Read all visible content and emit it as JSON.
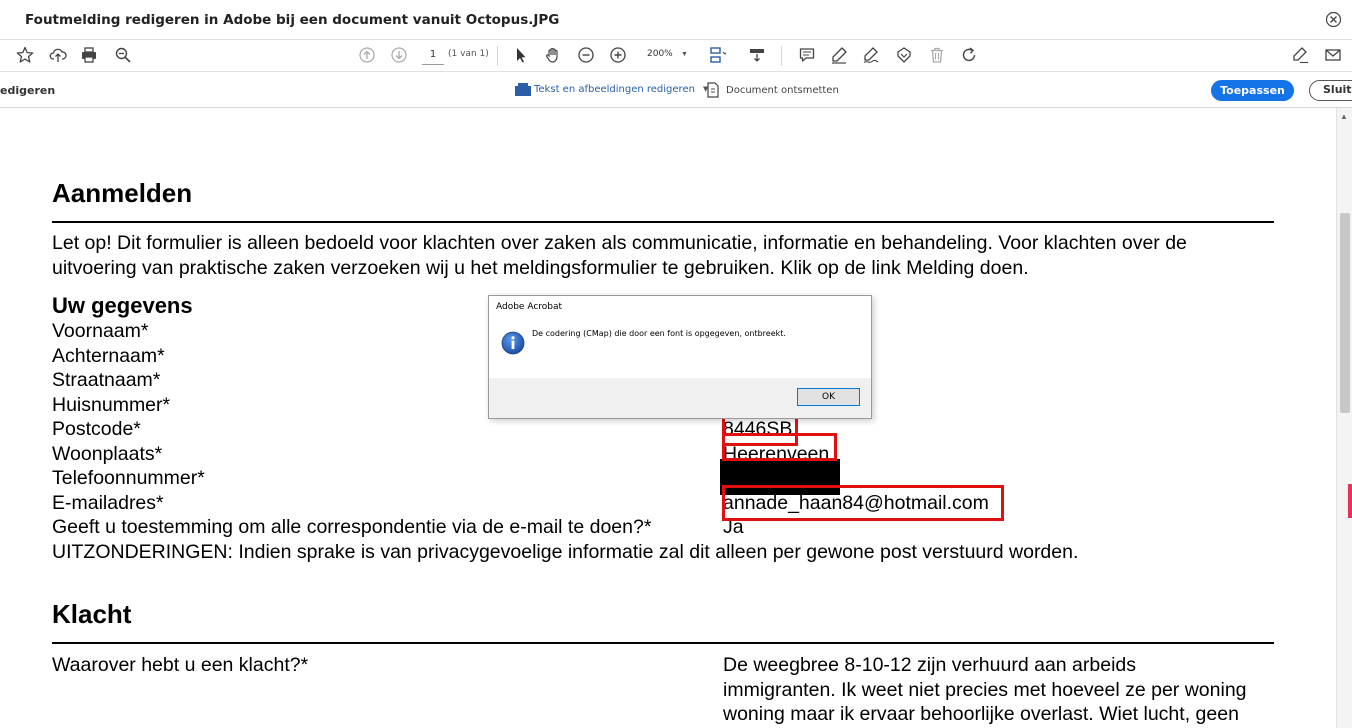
{
  "window": {
    "title": "Foutmelding redigeren in Adobe bij een document vanuit Octopus.JPG"
  },
  "toolbar": {
    "page_current": "1",
    "page_count": "(1 van 1)",
    "zoom": "200%"
  },
  "editbar": {
    "mode_label": "edigeren",
    "edit_tool_label": "Tekst en afbeeldingen redigeren",
    "sanitize_label": "Document ontsmetten",
    "apply_label": "Toepassen",
    "close_label": "Sluite"
  },
  "document": {
    "heading1": "Aanmelden",
    "intro_line1": "Let op! Dit formulier is alleen bedoeld voor klachten over zaken als communicatie, informatie en behandeling. Voor klachten over de",
    "intro_line2": "uitvoering van praktische zaken verzoeken wij u het meldingsformulier te gebruiken. Klik op de link Melding doen.",
    "section_label": "Uw gegevens",
    "fields": [
      {
        "label": "Voornaam*",
        "value": ""
      },
      {
        "label": "Achternaam*",
        "value": ""
      },
      {
        "label": "Straatnaam*",
        "value": ""
      },
      {
        "label": "Huisnummer*",
        "value": ""
      },
      {
        "label": "Postcode*",
        "value": "8446SB"
      },
      {
        "label": "Woonplaats*",
        "value": "Heerenveen"
      },
      {
        "label": "Telefoonnummer*",
        "value": ""
      },
      {
        "label": "E-mailadres*",
        "value": "annade_haan84@hotmail.com"
      },
      {
        "label": "Geeft u toestemming om alle correspondentie via de e-mail te doen?*",
        "value": "Ja"
      }
    ],
    "exceptions": "UITZONDERINGEN: Indien sprake is van privacygevoelige informatie zal dit alleen per gewone post verstuurd worden.",
    "heading2": "Klacht",
    "complaint_question": "Waarover hebt u een klacht?*",
    "complaint_line1": "De weegbree 8-10-12 zijn verhuurd aan arbeids",
    "complaint_line2": "immigranten. Ik weet niet precies met hoeveel ze per woning",
    "complaint_line3": "woning maar ik ervaar behoorlijke overlast. Wiet lucht, geen"
  },
  "dialog": {
    "title": "Adobe Acrobat",
    "message": "De codering (CMap) die door een font is opgegeven, ontbreekt.",
    "ok_label": "OK"
  },
  "colors": {
    "accent": "#1473e6",
    "highlight_box": "#e01010"
  }
}
